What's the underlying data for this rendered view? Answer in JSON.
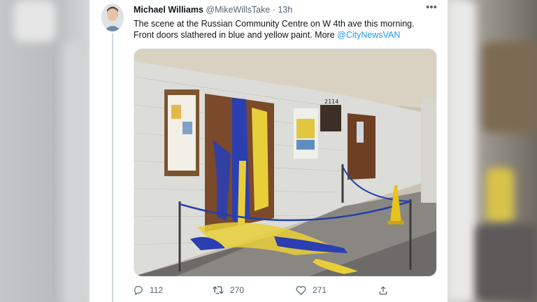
{
  "tweet": {
    "display_name": "Michael Williams",
    "handle": "@MikeWillsTake",
    "separator": "·",
    "time": "13h",
    "text_line1": "The scene at the Russian Community Centre on W 4th ave this morning.",
    "text_line2_prefix": "Front doors slathered in blue and yellow paint. More ",
    "mention": "@CityNewsVAN",
    "media": {
      "address_number": "2114"
    }
  },
  "actions": {
    "replies": "112",
    "retweets": "270",
    "likes": "271"
  },
  "icons": {
    "reply": "reply-icon",
    "retweet": "retweet-icon",
    "like": "heart-icon",
    "share": "share-icon",
    "more": "more-dots-icon"
  },
  "colors": {
    "link": "#1d9bf0",
    "muted": "#536471",
    "paint_blue": "#2b3fb0",
    "paint_yellow": "#e8cf3a"
  }
}
